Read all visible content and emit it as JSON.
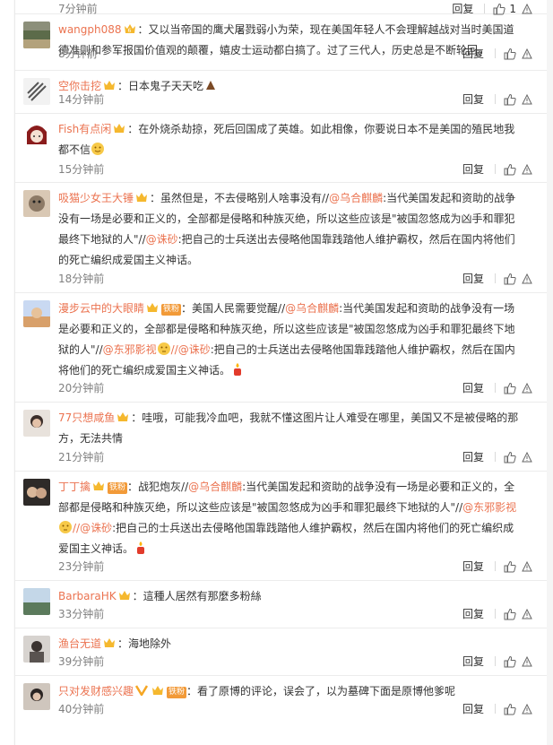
{
  "comments": [
    {
      "user": "",
      "text": "",
      "time": "7分钟前",
      "reply": "回复",
      "likes": "1"
    },
    {
      "user": "wangph088",
      "text": "：又以当帝国的鹰犬屠戮弱小为荣，现在美国年轻人不会理解越战对当时美国道德准则和参军报国价值观的颠覆，嬉皮士运动都白搞了。过了三代人，历史总是不断轮回。",
      "time": "8分钟前",
      "reply": "回复"
    },
    {
      "user": "空你击挖",
      "text": "：日本鬼子天天吃",
      "time": "14分钟前",
      "reply": "回复"
    },
    {
      "user": "Fish有点闲",
      "text": "：在外烧杀劫掠，死后回国成了英雄。如此相像，你要说日本不是美国的殖民地我都不信",
      "time": "15分钟前",
      "reply": "回复"
    },
    {
      "user": "吸猫少女王大锤",
      "text": "：虽然但是，不去侵略别人啥事没有//",
      "mention1": "@乌合麒麟",
      "text2": ":当代美国发起和资助的战争没有一场是必要和正义的，全部都是侵略和种族灭绝，所以这些应该是\"被国忽悠成为凶手和罪犯最终下地狱的人\"//",
      "mention2": "@诛砂",
      "text3": ":把自己的士兵送出去侵略他国靠践踏他人维护霸权，然后在国内将他们的死亡编织成爱国主义神话。",
      "time": "18分钟前",
      "reply": "回复"
    },
    {
      "user": "漫步云中的大眼睛",
      "fan": "铁粉",
      "text": "：美国人民需要觉醒//",
      "mention1": "@乌合麒麟",
      "text2": ":当代美国发起和资助的战争没有一场是必要和正义的，全部都是侵略和种族灭绝，所以这些应该是\"被国忽悠成为凶手和罪犯最终下地狱的人\"//",
      "mention2": "@东邪影视",
      "mention3": "//@诛砂",
      "text3": ":把自己的士兵送出去侵略他国靠践踏他人维护霸权，然后在国内将他们的死亡编织成爱国主义神话。",
      "time": "20分钟前",
      "reply": "回复"
    },
    {
      "user": "77只想咸鱼",
      "text": "：哇哦，可能我冷血吧，我就不懂这图片让人难受在哪里，美国又不是被侵略的那方，无法共情",
      "time": "21分钟前",
      "reply": "回复"
    },
    {
      "user": "丁丁擒",
      "fan": "铁粉",
      "text": "：战犯炮灰//",
      "mention1": "@乌合麒麟",
      "text2": ":当代美国发起和资助的战争没有一场是必要和正义的，全部都是侵略和种族灭绝，所以这些应该是\"被国忽悠成为凶手和罪犯最终下地狱的人\"//",
      "mention2": "@东邪影视",
      "mention3": "//@诛砂",
      "text3": ":把自己的士兵送出去侵略他国靠践踏他人维护霸权，然后在国内将他们的死亡编织成爱国主义神话。",
      "time": "23分钟前",
      "reply": "回复"
    },
    {
      "user": "BarbaraHK",
      "text": "：這種人居然有那麼多粉絲",
      "time": "33分钟前",
      "reply": "回复"
    },
    {
      "user": "渔台无道",
      "text": "：海地除外",
      "time": "39分钟前",
      "reply": "回复"
    },
    {
      "user": "只对发财感兴趣",
      "fan": "铁粉",
      "text": "：看了原博的评论，误会了，以为墓碑下面是原博他爹呢",
      "time": "40分钟前",
      "reply": "回复"
    }
  ],
  "colors": {
    "username": "#eb7350",
    "text": "#333333",
    "time": "#808080",
    "badge": "#f29a38"
  }
}
